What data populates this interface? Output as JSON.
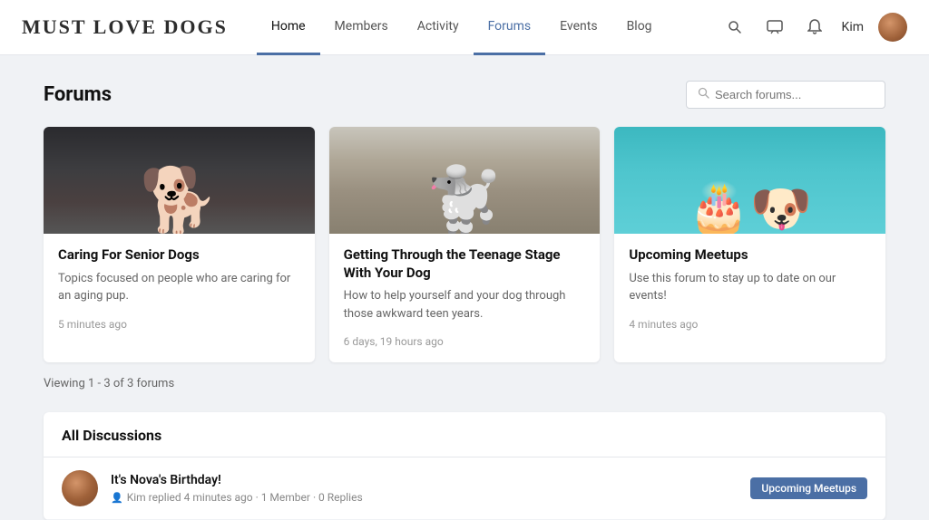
{
  "site": {
    "logo": "MUST LOVE DOGS"
  },
  "nav": {
    "items": [
      {
        "label": "Home",
        "state": "active-home"
      },
      {
        "label": "Members",
        "state": ""
      },
      {
        "label": "Activity",
        "state": ""
      },
      {
        "label": "Forums",
        "state": "active-forums"
      },
      {
        "label": "Events",
        "state": ""
      },
      {
        "label": "Blog",
        "state": ""
      }
    ]
  },
  "header_icons": {
    "search": "🔍",
    "messages": "💬",
    "notifications": "🔔"
  },
  "user": {
    "name": "Kim"
  },
  "page": {
    "title": "Forums"
  },
  "search": {
    "placeholder": "Search forums..."
  },
  "forum_cards": [
    {
      "title": "Caring For Senior Dogs",
      "description": "Topics focused on people who are caring for an aging pup.",
      "time": "5 minutes ago",
      "img_class": "card-img-1"
    },
    {
      "title": "Getting Through the Teenage Stage With Your Dog",
      "description": "How to help yourself and your dog through those awkward teen years.",
      "time": "6 days, 19 hours ago",
      "img_class": "card-img-2"
    },
    {
      "title": "Upcoming Meetups",
      "description": "Use this forum to stay up to date on our events!",
      "time": "4 minutes ago",
      "img_class": "card-img-3"
    }
  ],
  "viewing": {
    "text": "Viewing 1 - 3 of 3 forums"
  },
  "discussions": {
    "title": "All Discussions",
    "items": [
      {
        "title": "It's Nova's Birthday!",
        "meta": "Kim replied 4 minutes ago · 1 Member · 0 Replies",
        "badge": "Upcoming Meetups"
      }
    ]
  }
}
